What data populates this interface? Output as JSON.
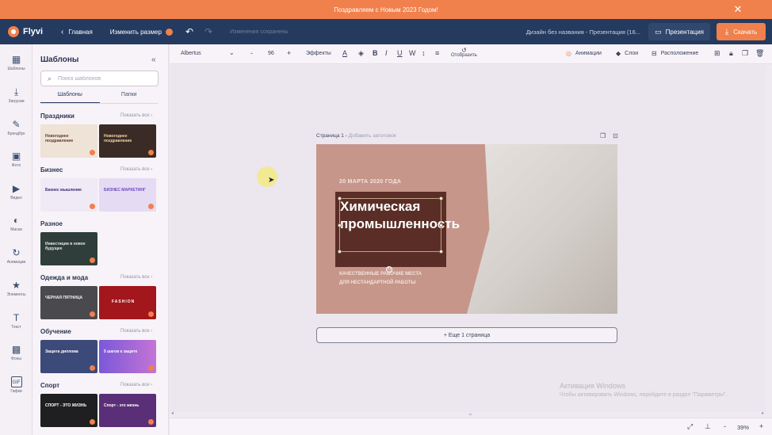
{
  "banner": {
    "text": "Поздравляем с Новым 2023 Годом!",
    "close": "✕"
  },
  "header": {
    "logo": "Flyvi",
    "home": "Главная",
    "resize": "Изменить размер",
    "changes": "Изменения сохранены",
    "doc_title": "Дизайн без названия - Презентация (16...",
    "presentation": "Презентация",
    "download": "Скачать"
  },
  "rail": [
    {
      "label": "Шаблоны",
      "icon": "templates-icon",
      "glyph": "▦"
    },
    {
      "label": "Загрузки",
      "icon": "upload-icon",
      "glyph": "⤓"
    },
    {
      "label": "Брендбук",
      "icon": "brandbook-icon",
      "glyph": "✎"
    },
    {
      "label": "Фото",
      "icon": "photo-icon",
      "glyph": "▣"
    },
    {
      "label": "Видео",
      "icon": "video-icon",
      "glyph": "▶"
    },
    {
      "label": "Маски",
      "icon": "masks-icon",
      "glyph": "◐"
    },
    {
      "label": "Анимации",
      "icon": "animation-icon",
      "glyph": "↻"
    },
    {
      "label": "Элементы",
      "icon": "elements-icon",
      "glyph": "★"
    },
    {
      "label": "Текст",
      "icon": "text-icon",
      "glyph": "T"
    },
    {
      "label": "Фоны",
      "icon": "backgrounds-icon",
      "glyph": "▩"
    },
    {
      "label": "Гифки",
      "icon": "gif-icon",
      "glyph": "GIF"
    }
  ],
  "panel": {
    "title": "Шаблоны",
    "search_placeholder": "Поиск шаблонов",
    "tabs": [
      "Шаблоны",
      "Папки"
    ],
    "show_all": "Показать все",
    "sections": [
      {
        "title": "Праздники",
        "thumbs": [
          {
            "text": "Новогоднее поздравление",
            "bg": "#efe2d6",
            "fg": "#5a3b2c"
          },
          {
            "text": "Новогоднее поздравление",
            "bg": "#3a2b26",
            "fg": "#f3d7a6"
          }
        ]
      },
      {
        "title": "Бизнес",
        "thumbs": [
          {
            "text": "Бизнес мышление",
            "bg": "#f0e9f6",
            "fg": "#3a2c6e"
          },
          {
            "text": "БИЗНЕС МАРКЕТИНГ",
            "bg": "#e5dbf3",
            "fg": "#6b4cc4"
          }
        ]
      },
      {
        "title": "Разное",
        "thumbs": [
          {
            "text": "Инвестиции в новое будущее",
            "bg": "#2f3e3a",
            "fg": "#e8e8e8"
          }
        ]
      },
      {
        "title": "Одежда и мода",
        "thumbs": [
          {
            "text": "ЧЕРНАЯ ПЯТНИЦА",
            "bg": "#4a4a4e",
            "fg": "#f2f2f2"
          },
          {
            "text": "FASHION",
            "bg": "#a2161c",
            "fg": "#fff"
          }
        ]
      },
      {
        "title": "Обучение",
        "thumbs": [
          {
            "text": "Защита диплома",
            "bg": "#3c4a7a",
            "fg": "#fff"
          },
          {
            "text": "5 шагов к защите",
            "bg": "#7a58d8",
            "fg": "#fff"
          }
        ]
      },
      {
        "title": "Спорт",
        "thumbs": [
          {
            "text": "СПОРТ - ЭТО ЖИЗНЬ",
            "bg": "#1f1f22",
            "fg": "#fff"
          },
          {
            "text": "Спорт - это жизнь",
            "bg": "#5a2f78",
            "fg": "#fff"
          }
        ]
      }
    ]
  },
  "toolbar": {
    "font": "Albertus",
    "size": "96",
    "effects": "Эффекты",
    "flip": "Отобразить",
    "animations": "Анимации",
    "layers": "Слои",
    "arrange": "Расположение"
  },
  "canvas": {
    "page_label": "Страница 1 -",
    "page_sub": " Добавить заголовок",
    "slide_date": "20 МАРТА 2020 ГОДА",
    "slide_title": "Химическая промышленность",
    "slide_sub_line1": "КАЧЕСТВЕННЫЕ РАБОЧИЕ МЕСТА",
    "slide_sub_line2": "ДЛЯ НЕСТАНДАРТНОЙ РАБОТЫ",
    "add_page": "+ Еще 1 страница",
    "activation_title": "Активация Windows",
    "activation_sub": "Чтобы активировать Windows, перейдите в раздел \"Параметры\"."
  },
  "zoom": "39%",
  "colors": {
    "banner": "#f0804c",
    "header": "#243a5e",
    "accent": "#f0804c",
    "slide_bg": "#c6968b",
    "title_box": "#5a2e26"
  }
}
